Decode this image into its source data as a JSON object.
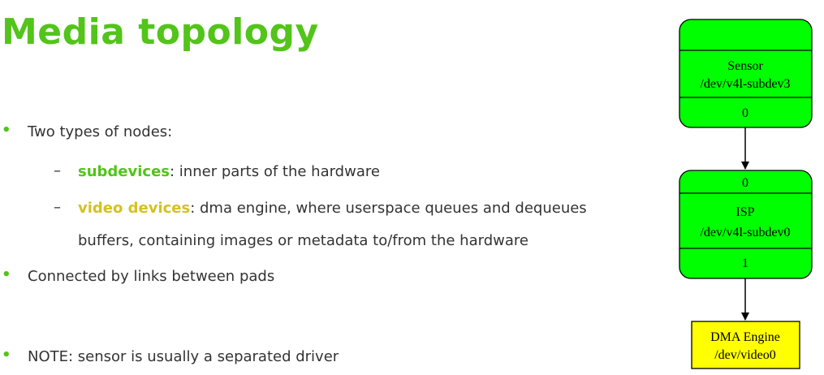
{
  "slide": {
    "title": "Media topology",
    "bullets": {
      "b1": "Two types of nodes:",
      "sub1_term": "subdevices",
      "sub1_rest": ": inner parts of the hardware",
      "sub2_term": "video devices",
      "sub2_rest": ": dma engine, where userspace queues and dequeues",
      "sub2_cont": "buffers, containing images or metadata to/from the hardware",
      "b2": "Connected by links between pads",
      "b3": "NOTE: sensor is usually a separated driver"
    }
  },
  "diagram": {
    "colors": {
      "subdevice": "#00ff00",
      "video": "#ffff00",
      "stroke": "#000000"
    },
    "sensor": {
      "name": "Sensor",
      "path": "/dev/v4l-subdev3",
      "pad_out": "0"
    },
    "isp": {
      "pad_in": "0",
      "name": "ISP",
      "path": "/dev/v4l-subdev0",
      "pad_out": "1"
    },
    "dma": {
      "name": "DMA Engine",
      "path": "/dev/video0"
    }
  }
}
